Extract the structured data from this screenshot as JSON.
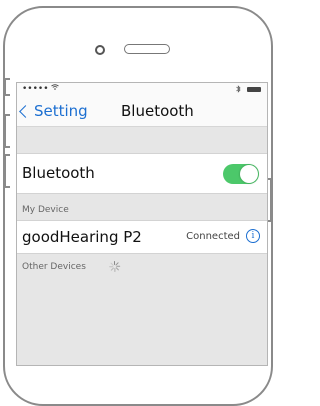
{
  "status_bar": {
    "signal": "••••• ",
    "wifi_icon": "wifi-icon",
    "bluetooth_icon": "bluetooth-icon",
    "battery_icon": "battery-icon"
  },
  "nav": {
    "back_label": "Setting",
    "title": "Bluetooth"
  },
  "bluetooth_row": {
    "label": "Bluetooth",
    "toggle_on": true,
    "toggle_color": "#4cc86a"
  },
  "my_device": {
    "header": "My Device",
    "device_name": "goodHearing P2",
    "device_status": "Connected",
    "info_glyph": "i"
  },
  "other_devices": {
    "header": "Other Devices"
  },
  "colors": {
    "accent": "#1c6fd1",
    "background": "#e6e6e6"
  }
}
